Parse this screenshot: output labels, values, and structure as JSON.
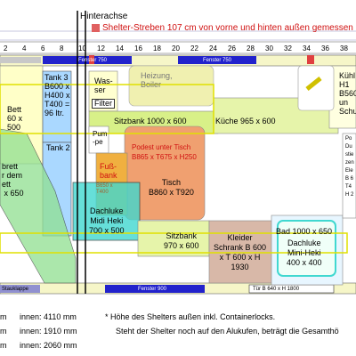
{
  "header": {
    "hinterachse": "Hinterachse",
    "note": "Shelter-Streben 107 cm von vorne und hinten außen gemessen"
  },
  "ruler": [
    "2",
    "4",
    "6",
    "8",
    "10",
    "12",
    "14",
    "16",
    "18",
    "20",
    "22",
    "24",
    "26",
    "28",
    "30",
    "32",
    "34",
    "36",
    "38"
  ],
  "windows": {
    "top_left": "Fenster 750",
    "top_right": "Fenster 750",
    "bottom": "Fenster 900",
    "bottom_left_tag": "Stauklappe",
    "door": "Tür B 640 x H 1800"
  },
  "rooms": {
    "bett": "Bett\n60 x\n500",
    "tank3": "Tank 3\nB600 x\nH400 x\nT400 =\n96 ltr.",
    "wasser": "Was-\nser",
    "filter": "Filter",
    "heizung": "Heizung,\nBoiler",
    "kuehl": "Kühl\nH1\nB560\nun\nSchu",
    "sitzbank_top": "Sitzbank 1000 x 600",
    "kueche": "Küche 965 x 600",
    "pumpe": "Pum\n-pe",
    "tank2": "Tank 2",
    "klappbrett": "brett\nr dem\nett\n x 650",
    "podest": "Podest unter Tisch\nB865 x T675 x H250",
    "fussbank": "Fuß-\nbank",
    "fussbank_sub": "B650 x\nT400",
    "tisch": "Tisch\nB860 x T920",
    "dachluke_midi": "Dachluke\nMidi Heki\n700 x 500",
    "sitzbank_mid": "Sitzbank\n970 x 600",
    "kleiderschrank": "Kleider\nSchrank B 600\nx T 600 x H\n1930",
    "bad": "Bad 1000 x 650",
    "dachluke_mini": "Dachluke\nMini-Heki\n400 x 400",
    "right_col": "Po\nDu\nstie\nzen\nEle\nB 6\nT4\nH 2"
  },
  "footer": {
    "line1_left": "m",
    "line1_value": "innen: 4110 mm",
    "line1_note": "*   Höhe des Shelters außen inkl. Containerlocks.",
    "line2_left": "m",
    "line2_value": "innen: 1910 mm",
    "line2_note": "Steht der Shelter noch auf den Alukufen, beträgt die Gesamthö",
    "line3_left": "m",
    "line3_value": "innen: 2060 mm"
  }
}
